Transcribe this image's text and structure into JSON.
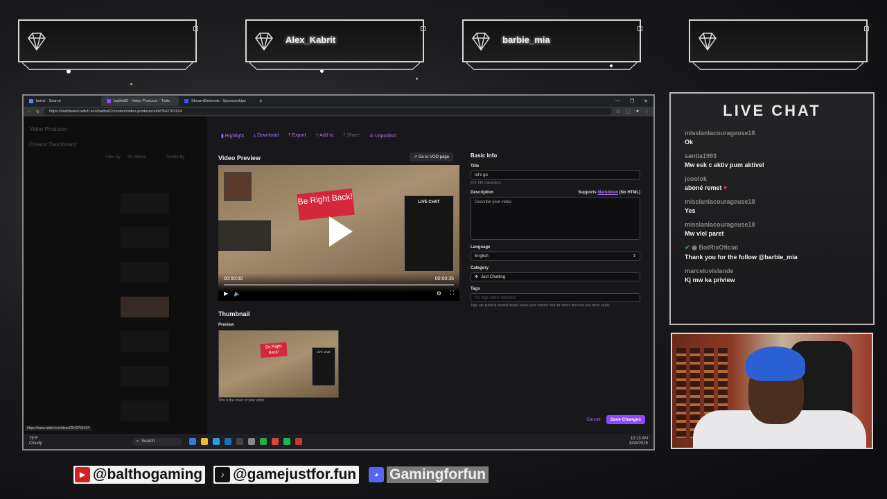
{
  "badges": [
    {
      "name": ""
    },
    {
      "name": "Alex_Kabrit"
    },
    {
      "name": "barbie_mia"
    },
    {
      "name": ""
    }
  ],
  "browser": {
    "tabs": [
      {
        "label": "botrix - Search",
        "color": "#4f8cff"
      },
      {
        "label": "baltho82 - Video Producer - Twitc",
        "color": "#9147ff"
      },
      {
        "label": "StreamElements - Sponsorships",
        "color": "#3355ff"
      }
    ],
    "url": "https://dashboard.twitch.tv/u/baltho82/content/video-producer/edit/2542763164",
    "status_url": "https://www.twitch.tv/videos/2542763164"
  },
  "sidebar": {
    "title": "Video Producer",
    "sub": "Creator Dashboard",
    "filter": "Filter By",
    "all_videos": "All Videos",
    "sort": "Sorted By"
  },
  "actions": [
    {
      "label": "Highlight",
      "icon": "highlight-icon",
      "disabled": false
    },
    {
      "label": "Download",
      "icon": "download-icon",
      "disabled": false
    },
    {
      "label": "Export",
      "icon": "export-icon",
      "disabled": false
    },
    {
      "label": "Add to",
      "icon": "plus-icon",
      "disabled": false
    },
    {
      "label": "Share",
      "icon": "share-icon",
      "disabled": true
    },
    {
      "label": "Unpublish",
      "icon": "unpublish-icon",
      "disabled": false
    }
  ],
  "video": {
    "section_title": "Video Preview",
    "vod_button": "Go to VOD page",
    "sign_text": "Be Right Back!",
    "chat_panel_title": "LIVE CHAT",
    "time_current": "00:00:00",
    "time_total": "00:00:35"
  },
  "thumbnail": {
    "section_title": "Thumbnail",
    "preview_label": "Preview",
    "caption": "This is the cover of your video"
  },
  "basic_info": {
    "title": "Basic Info",
    "title_label": "Title",
    "title_value": "let's go",
    "title_hint": "8 of 140 characters.",
    "desc_label": "Description",
    "desc_supports": "Supports",
    "desc_markdown": "Markdown",
    "desc_nohtml": "(No HTML)",
    "desc_placeholder": "Describe your video",
    "language_label": "Language",
    "language_value": "English",
    "category_label": "Category",
    "category_value": "Just Chatting",
    "tags_label": "Tags",
    "tags_placeholder": "No tags were selected",
    "tags_hint": "Tags are publicly shared details about your content that let others discover you more easily."
  },
  "footer": {
    "cancel": "Cancel",
    "save": "Save Changes"
  },
  "taskbar": {
    "temp": "79°F",
    "weather": "Cloudy",
    "search": "Search",
    "time": "10:13 AM",
    "date": "8/18/2025"
  },
  "chat": {
    "title": "LIVE CHAT",
    "messages": [
      {
        "user": "misslanlacourageuse18",
        "text": "Ok"
      },
      {
        "user": "santia1993",
        "text": "Mw esk c aktiv pum aktivel"
      },
      {
        "user": "jooolok",
        "text": "aboné remet"
      },
      {
        "user": "misslanlacourageuse18",
        "text": "Yes"
      },
      {
        "user": "misslanlacourageuse18",
        "text": "Mw vlel paret"
      },
      {
        "user": "BotRixOficial",
        "text": "Thank you for the follow @barbie_mia"
      },
      {
        "user": "marceluvislande",
        "text": "Kj mw ka priview"
      }
    ]
  },
  "socials": {
    "youtube": "@balthogaming",
    "tiktok": "@gamejustfor.fun",
    "discord": "Gamingforfun"
  }
}
